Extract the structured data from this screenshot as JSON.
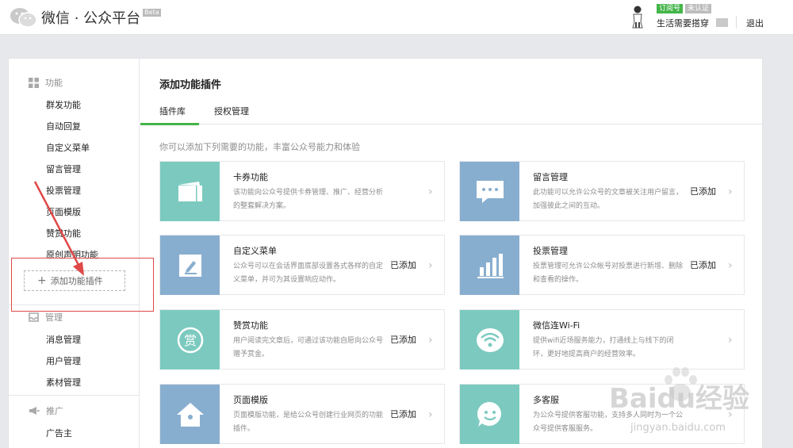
{
  "header": {
    "app_title": "微信 · 公众平台",
    "beta_label": "Beta",
    "account": {
      "subscription_badge": "订阅号",
      "unverified_badge": "未认证",
      "name": "生活需要搭穿",
      "logout_label": "退出"
    }
  },
  "sidebar": {
    "sections": [
      {
        "label": "功能",
        "icon": "grid-icon"
      },
      {
        "label": "管理",
        "icon": "inbox-icon"
      },
      {
        "label": "推广",
        "icon": "megaphone-icon"
      }
    ],
    "function_items": [
      "群发功能",
      "自动回复",
      "自定义菜单",
      "留言管理",
      "投票管理",
      "页面模版",
      "赞赏功能",
      "原创声明功能"
    ],
    "add_plugin_label": "添加功能插件",
    "manage_items": [
      "消息管理",
      "用户管理",
      "素材管理"
    ],
    "promo_items": [
      "广告主"
    ]
  },
  "main": {
    "title": "添加功能插件",
    "tabs": [
      "插件库",
      "授权管理"
    ],
    "active_tab": "插件库",
    "intro": "你可以添加下列需要的功能，丰富公众号能力和体验",
    "plugins": [
      {
        "title": "卡券功能",
        "desc": "该功能向公众号提供卡券管理、推广、经营分析的整套解决方案。",
        "status": "",
        "icon": "card-icon",
        "color": "#7ccabf"
      },
      {
        "title": "留言管理",
        "desc": "此功能可以允许公众号的文章被关注用户留言，加强彼此之间的互动。",
        "status": "已添加",
        "icon": "chat-icon",
        "color": "#88aecf"
      },
      {
        "title": "自定义菜单",
        "desc": "公众号可以在会话界面底部设置各式各样的自定义菜单，并可为其设置响应动作。",
        "status": "已添加",
        "icon": "edit-icon",
        "color": "#88aecf"
      },
      {
        "title": "投票管理",
        "desc": "投票管理可允许公众帐号对投票进行新增、删除和查看的操作。",
        "status": "已添加",
        "icon": "bar-chart-icon",
        "color": "#88aecf"
      },
      {
        "title": "赞赏功能",
        "desc": "用户阅读完文章后，可通过该功能自愿向公众号赠予赏金。",
        "status": "已添加",
        "icon": "reward-icon",
        "color": "#7ccabf"
      },
      {
        "title": "微信连Wi-Fi",
        "desc": "提供wifi近场服务能力，打通线上与线下的闭环，更好地提高商户的经营效率。",
        "status": "",
        "icon": "wifi-icon",
        "color": "#7ccabf"
      },
      {
        "title": "页面模版",
        "desc": "页面模版功能，是给公众号创建行业网页的功能插件。",
        "status": "已添加",
        "icon": "home-icon",
        "color": "#88aecf"
      },
      {
        "title": "多客服",
        "desc": "为公众号提供客服功能，支持多人同时为一个公众号提供客服服务。",
        "status": "",
        "icon": "smile-icon",
        "color": "#7ccabf"
      }
    ],
    "reward_glyph": "赏"
  },
  "watermark": {
    "text": "Baidu经验",
    "url": "jingyan.baidu.com"
  },
  "colors": {
    "accent": "#44b549",
    "teal": "#7ccabf",
    "blue": "#88aecf",
    "annotation": "#e04848"
  }
}
